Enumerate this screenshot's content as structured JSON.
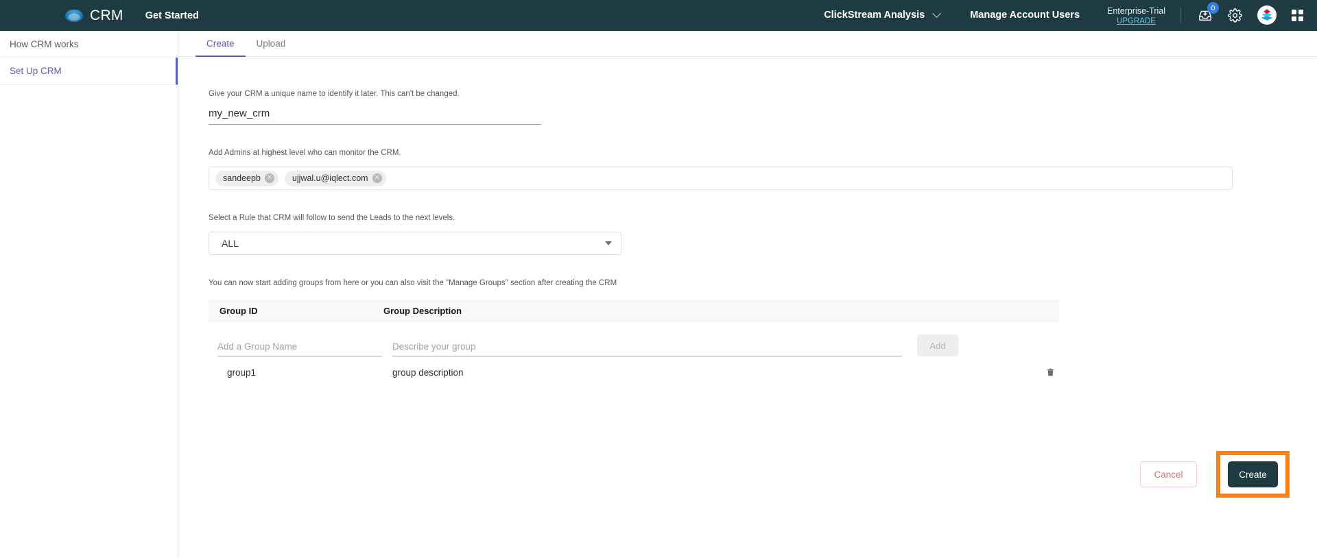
{
  "topbar": {
    "brand": "CRM",
    "get_started": "Get Started",
    "analysis_menu": "ClickStream Analysis",
    "manage_account_users": "Manage Account Users",
    "plan_name": "Enterprise-Trial",
    "upgrade_label": "UPGRADE",
    "inbox_badge": "0",
    "brand_color": "#1d3b40",
    "badge_color": "#2f7fe4"
  },
  "sidebar": {
    "items": [
      {
        "label": "How CRM works",
        "active": false
      },
      {
        "label": "Set Up CRM",
        "active": true
      }
    ],
    "active_color": "#5c5cae"
  },
  "tabs": [
    {
      "label": "Create",
      "active": true
    },
    {
      "label": "Upload",
      "active": false
    }
  ],
  "form": {
    "name_hint": "Give your CRM a unique name to identify it later. This can't be changed.",
    "name_value": "my_new_crm",
    "admins_hint": "Add Admins at highest level who can monitor the CRM.",
    "admin_chips": [
      "sandeepb",
      "ujjwal.u@iqlect.com"
    ],
    "rule_hint": "Select a Rule that CRM will follow to send the Leads to the next levels.",
    "rule_value": "ALL",
    "groups_hint": "You can now start adding groups from here or you can also visit the \"Manage Groups\" section after creating the CRM"
  },
  "groups_table": {
    "columns": [
      "Group ID",
      "Group Description"
    ],
    "new_group_name_placeholder": "Add a Group Name",
    "new_group_desc_placeholder": "Describe your group",
    "new_group_name_value": "",
    "new_group_desc_value": "",
    "add_label": "Add",
    "rows": [
      {
        "id": "group1",
        "description": "group description"
      }
    ]
  },
  "actions": {
    "cancel_label": "Cancel",
    "create_label": "Create",
    "highlight_color": "#f08322"
  }
}
